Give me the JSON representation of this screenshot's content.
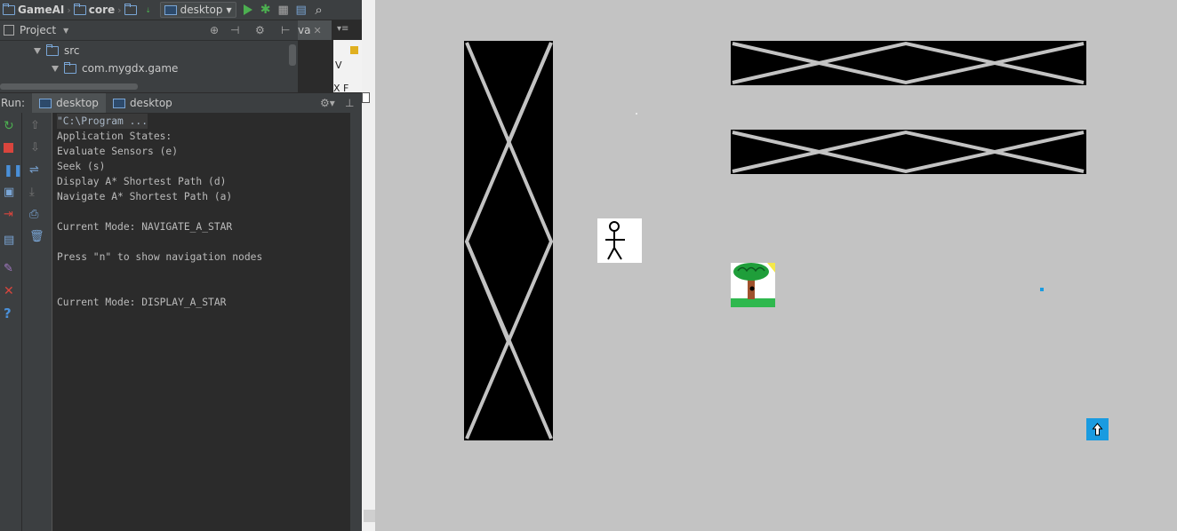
{
  "toolbar": {
    "project_name": "GameAI",
    "module_name": "core",
    "run_config": "desktop",
    "icons": [
      "folder-icon",
      "sort-icon",
      "run-icon",
      "debug-icon",
      "coverage-icon",
      "structure-icon",
      "search-icon"
    ]
  },
  "project_panel": {
    "title": "Project",
    "tree": [
      {
        "label": "src",
        "expanded": true
      },
      {
        "label": "com.mygdx.game",
        "expanded": true
      }
    ]
  },
  "editor_tab_fragment": "va",
  "editor_fragment_2": "X F",
  "run_panel": {
    "label": "Run:",
    "tabs": [
      {
        "label": "desktop",
        "active": true
      },
      {
        "label": "desktop",
        "active": false
      }
    ]
  },
  "console": {
    "lines": [
      "\"C:\\Program ...",
      "Application States:",
      "Evaluate Sensors (e)",
      "Seek (s)",
      "Display A* Shortest Path (d)",
      "Navigate A* Shortest Path (a)",
      "",
      "Current Mode: NAVIGATE_A_STAR",
      "",
      "Press \"n\" to show navigation nodes",
      "",
      "",
      "Current Mode: DISPLAY_A_STAR"
    ]
  },
  "game": {
    "background": "#c3c3c3",
    "wall_color": "#000000",
    "cross_color": "#c3c3c3",
    "agent_icon": "stick-figure-icon",
    "target_icon": "tree-icon",
    "marker_color": "#1a9be0",
    "arrow_icon": "up-arrow-icon"
  }
}
